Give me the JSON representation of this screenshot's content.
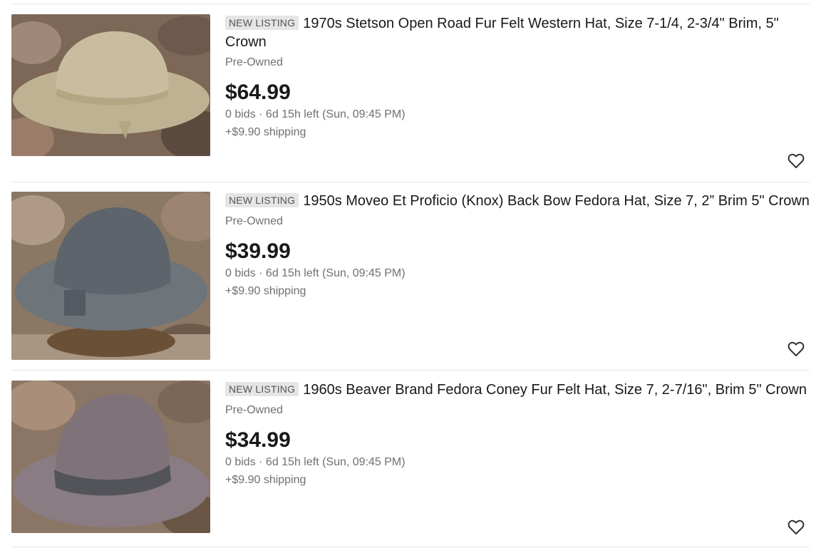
{
  "colors": {
    "text_primary": "#191919",
    "text_secondary": "#707070",
    "badge_bg": "#e5e5e5",
    "divider": "#e5e5e5"
  },
  "listings": [
    {
      "badge": "NEW LISTING",
      "title": "1970s Stetson Open Road Fur Felt Western Hat, Size 7-1/4, 2-3/4\" Brim, 5\" Crown",
      "condition": "Pre-Owned",
      "price": "$64.99",
      "bids_time": "0 bids · 6d 15h left (Sun, 09:45 PM)",
      "shipping": "+$9.90 shipping",
      "watch_icon": "heart-outline-icon",
      "image_colors": {
        "hat": "#c9bc9f",
        "band": "#b3a683",
        "bg": "#7d6757"
      }
    },
    {
      "badge": "NEW LISTING",
      "title": "1950s Moveo Et Proficio (Knox) Back Bow Fedora Hat, Size 7, 2” Brim 5\" Crown",
      "condition": "Pre-Owned",
      "price": "$39.99",
      "bids_time": "0 bids · 6d 15h left (Sun, 09:45 PM)",
      "shipping": "+$9.90 shipping",
      "watch_icon": "heart-outline-icon",
      "image_colors": {
        "hat": "#5d646b",
        "band": "#6d747a",
        "bg": "#8a7865"
      }
    },
    {
      "badge": "NEW LISTING",
      "title": "1960s Beaver Brand Fedora Coney Fur Felt Hat, Size 7, 2-7/16\", Brim 5\" Crown",
      "condition": "Pre-Owned",
      "price": "$34.99",
      "bids_time": "0 bids · 6d 15h left (Sun, 09:45 PM)",
      "shipping": "+$9.90 shipping",
      "watch_icon": "heart-outline-icon",
      "image_colors": {
        "hat": "#7f7279",
        "band": "#53545a",
        "bg": "#8b7666"
      }
    }
  ]
}
